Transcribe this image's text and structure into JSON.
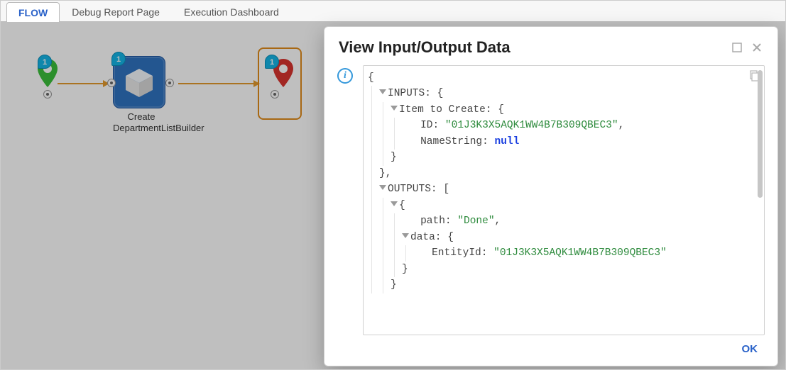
{
  "tabs": [
    {
      "label": "FLOW",
      "active": true
    },
    {
      "label": "Debug Report Page",
      "active": false
    },
    {
      "label": "Execution Dashboard",
      "active": false
    }
  ],
  "flow": {
    "start_badge": "1",
    "step_badge": "1",
    "step_label_line1": "Create",
    "step_label_line2": "DepartmentListBuilder",
    "end_badge": "1"
  },
  "modal": {
    "title": "View Input/Output Data",
    "ok_label": "OK",
    "data": {
      "open": "{",
      "inputs_label": "INPUTS:",
      "inputs_open": "{",
      "item_label": "Item to Create:",
      "item_open": "{",
      "id_key": "ID:",
      "id_val": "\"01J3K3X5AQK1WW4B7B309QBEC3\"",
      "name_key": "NameString:",
      "name_val": "null",
      "item_close": "}",
      "inputs_close": "},",
      "outputs_label": "OUTPUTS:",
      "outputs_open": "[",
      "obj_open": "{",
      "path_key": "path:",
      "path_val": "\"Done\"",
      "data_key": "data:",
      "data_open": "{",
      "entity_key": "EntityId:",
      "entity_val": "\"01J3K3X5AQK1WW4B7B309QBEC3\"",
      "data_close": "}",
      "obj_close": "}"
    }
  }
}
